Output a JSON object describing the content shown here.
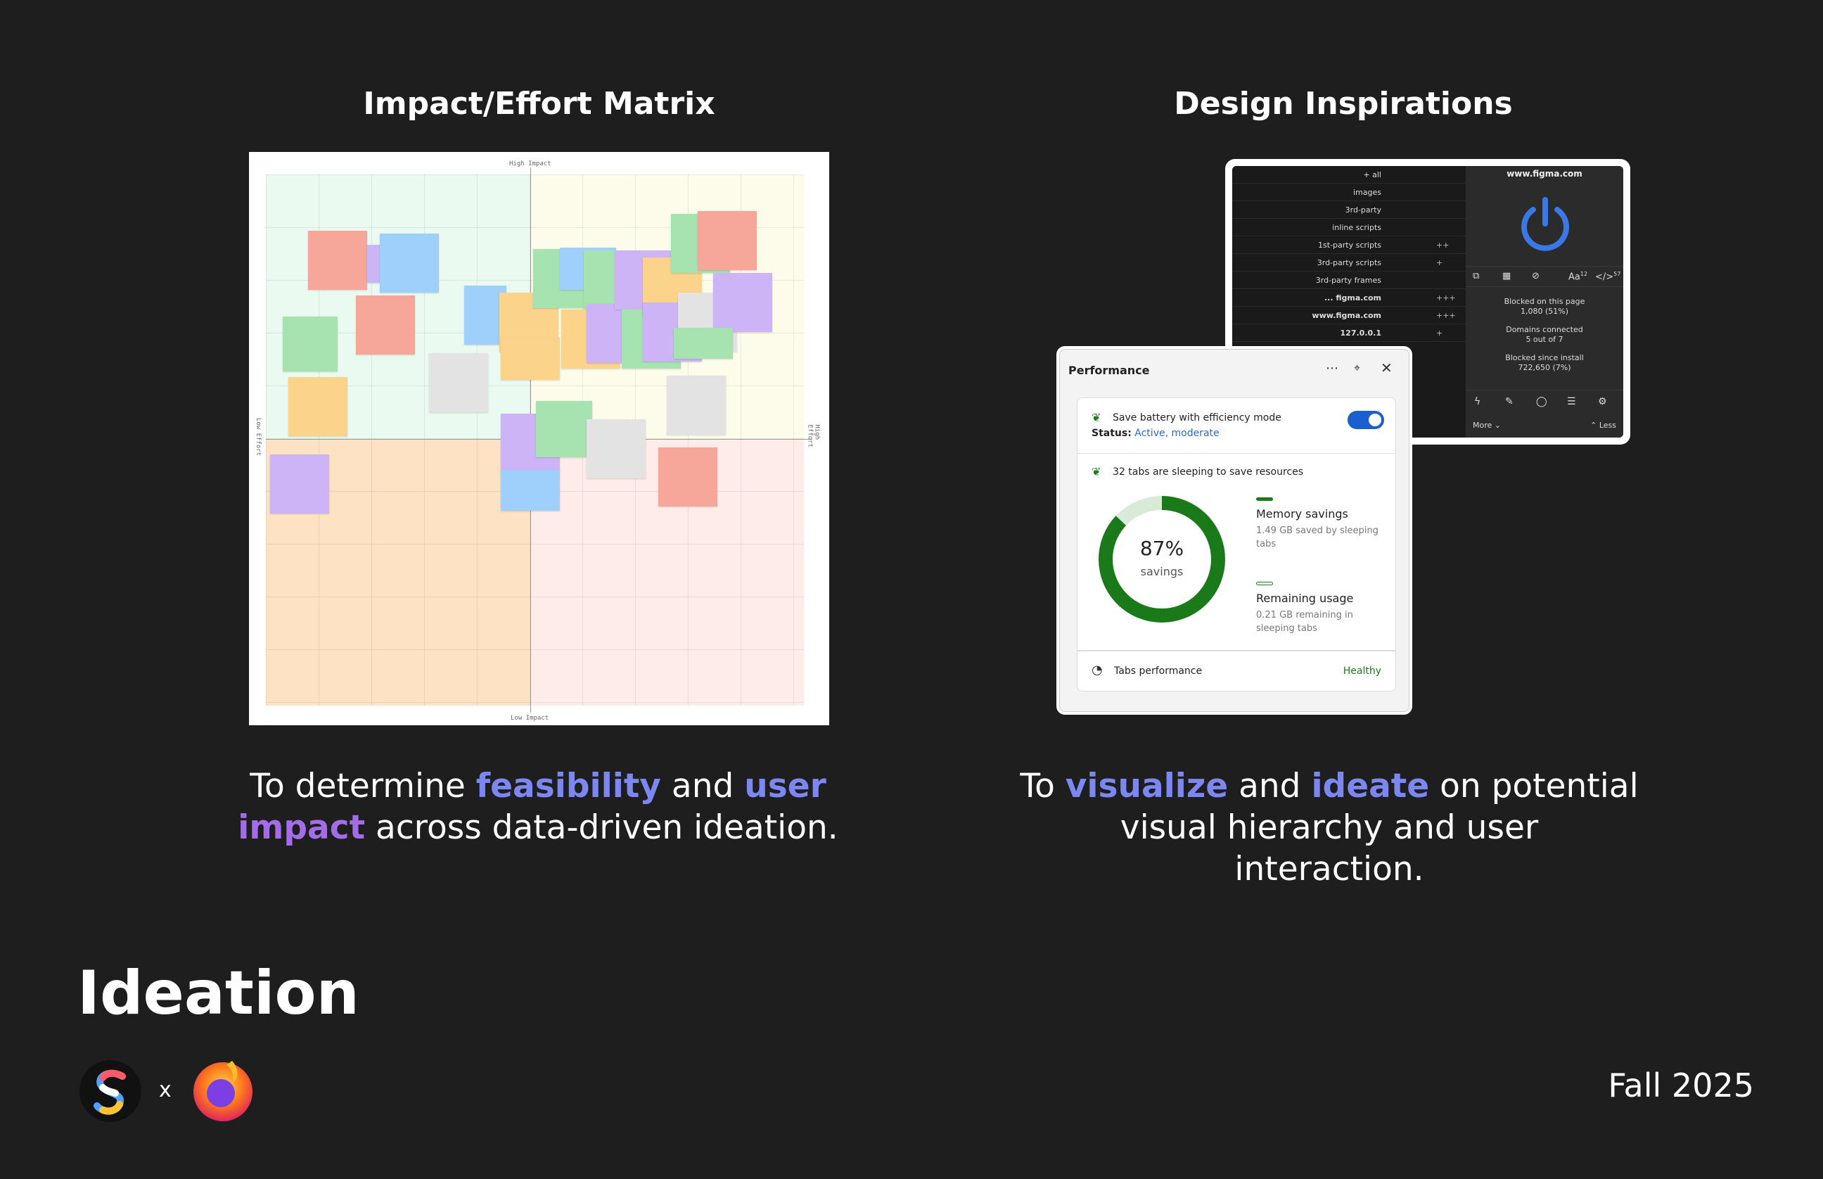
{
  "left": {
    "title": "Impact/Effort Matrix",
    "caption": {
      "t1": "To determine ",
      "h1": "feasibility",
      "t2": " and ",
      "h2": "user",
      "h3": "impact",
      "t3": " across data-driven ideation."
    },
    "matrix": {
      "top_label": "High Impact",
      "bottom_label": "Low Impact",
      "left_label": "Low Effort",
      "right_label": "High Effort"
    }
  },
  "right": {
    "title": "Design Inspirations",
    "caption": {
      "t1": "To ",
      "h1": "visualize",
      "t2": " and ",
      "h2": "ideate",
      "t3": " on potential",
      "l2": "visual hierarchy and user",
      "l3": "interaction."
    },
    "ublock": {
      "rows": [
        {
          "name": "+ all",
          "count": ""
        },
        {
          "name": "images",
          "count": ""
        },
        {
          "name": "3rd-party",
          "count": ""
        },
        {
          "name": "inline scripts",
          "count": ""
        },
        {
          "name": "1st-party scripts",
          "count": "++"
        },
        {
          "name": "3rd-party scripts",
          "count": "+"
        },
        {
          "name": "3rd-party frames",
          "count": ""
        },
        {
          "name": "... figma.com",
          "count": "+++"
        },
        {
          "name": "www.figma.com",
          "count": "+++"
        },
        {
          "name": "127.0.0.1",
          "count": "+"
        }
      ],
      "domain": "www.figma.com",
      "blocked_page_label": "Blocked on this page",
      "blocked_page_value": "1,080 (51%)",
      "domains_label": "Domains connected",
      "domains_value": "5 out of 7",
      "blocked_install_label": "Blocked since install",
      "blocked_install_value": "722,650 (7%)",
      "more": "More",
      "less": "Less",
      "aa_sup": "12",
      "code_sup": "57"
    },
    "perf": {
      "title": "Performance",
      "battery": "Save battery with efficiency mode",
      "status_label": "Status:",
      "status_value": "Active, moderate",
      "sleeping": "32 tabs are sleeping to save resources",
      "percent": "87%",
      "savings": "savings",
      "percent_value": 87,
      "mem_title": "Memory savings",
      "mem_desc": "1.49 GB saved by sleeping tabs",
      "rem_title": "Remaining usage",
      "rem_desc": "0.21 GB remaining in sleeping tabs",
      "tabs_perf": "Tabs performance",
      "healthy": "Healthy",
      "colors": {
        "accent": "#1a7a1a",
        "toggle": "#1a5fd0",
        "link": "#2a6ad0"
      }
    }
  },
  "footer": {
    "heading": "Ideation",
    "x": "x",
    "term": "Fall 2025"
  }
}
